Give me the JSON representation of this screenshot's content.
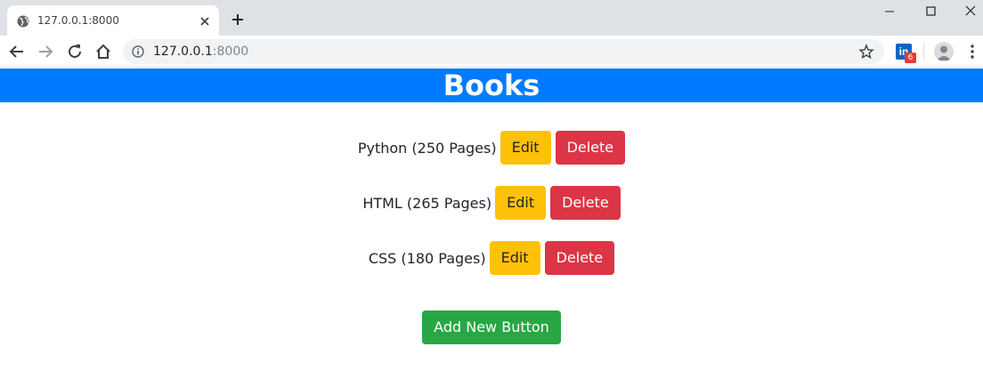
{
  "browser": {
    "tab": {
      "title": "127.0.0.1:8000"
    },
    "address": {
      "host": "127.0.0.1",
      "port": ":8000"
    },
    "extension_badge": "6",
    "extension_letter": "in"
  },
  "page": {
    "title": "Books",
    "books": [
      {
        "label": "Python (250 Pages)",
        "edit": "Edit",
        "delete": "Delete"
      },
      {
        "label": "HTML (265 Pages)",
        "edit": "Edit",
        "delete": "Delete"
      },
      {
        "label": "CSS (180 Pages)",
        "edit": "Edit",
        "delete": "Delete"
      }
    ],
    "add_button": "Add New Button"
  },
  "colors": {
    "header": "#007bff",
    "edit": "#ffc107",
    "delete": "#dc3545",
    "add": "#28a745"
  }
}
